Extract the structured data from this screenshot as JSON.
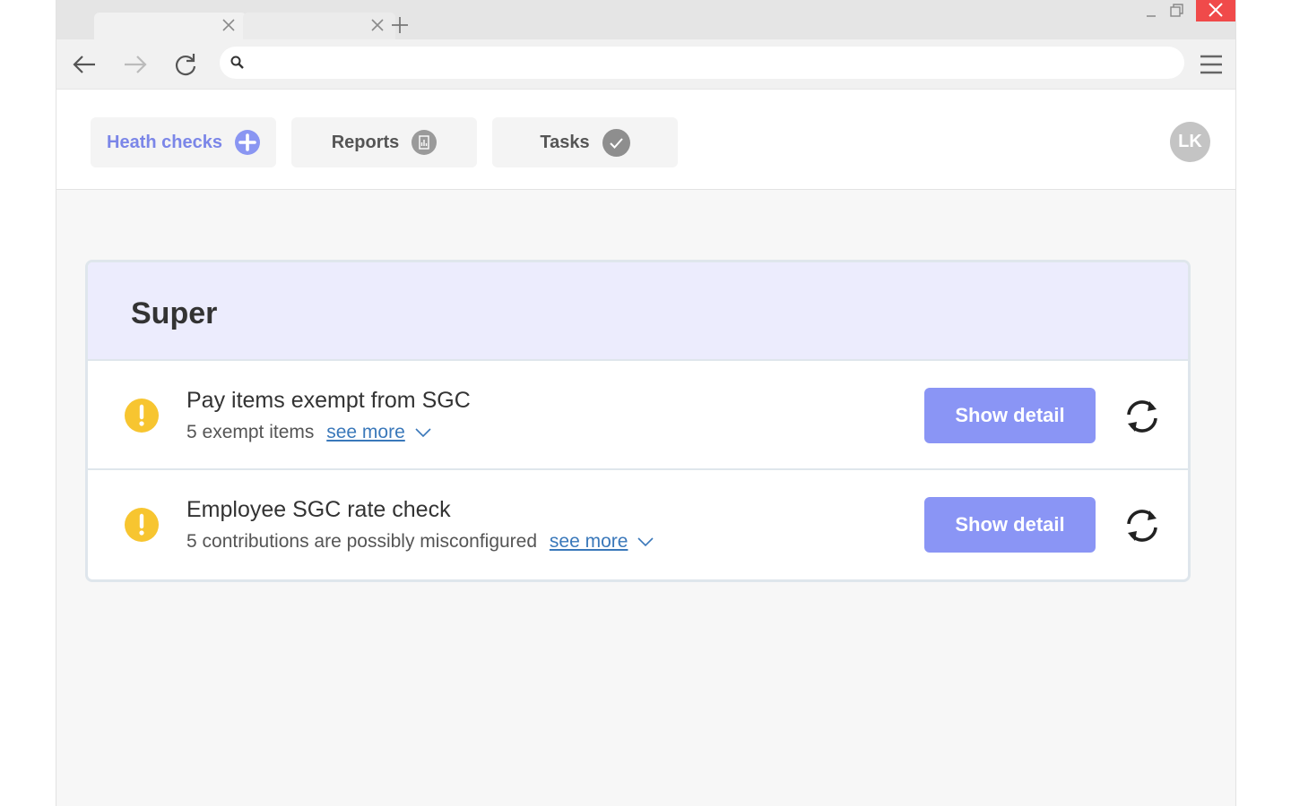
{
  "browser": {
    "url_value": "",
    "icons": [
      "close-icon",
      "plus-icon",
      "minimize-icon",
      "restore-icon",
      "back-arrow-icon",
      "forward-arrow-icon",
      "reload-icon",
      "search-icon",
      "hamburger-menu-icon"
    ],
    "close_color": "#f04a4a"
  },
  "app": {
    "tabs": [
      {
        "label": "Heath checks",
        "icon": "plus-circle-icon",
        "active": true
      },
      {
        "label": "Reports",
        "icon": "report-icon",
        "active": false
      },
      {
        "label": "Tasks",
        "icon": "check-circle-icon",
        "active": false
      }
    ],
    "avatar_initials": "LK",
    "accent_color": "#8a95f5"
  },
  "card": {
    "title": "Super",
    "items": [
      {
        "title": "Pay items exempt from SGC",
        "subtitle": "5 exempt items",
        "link": "see more",
        "button": "Show detail",
        "status_icon": "warning-icon"
      },
      {
        "title": "Employee SGC rate check",
        "subtitle": "5 contributions are possibly misconfigured",
        "link": "see more",
        "button": "Show detail",
        "status_icon": "warning-icon"
      }
    ]
  }
}
